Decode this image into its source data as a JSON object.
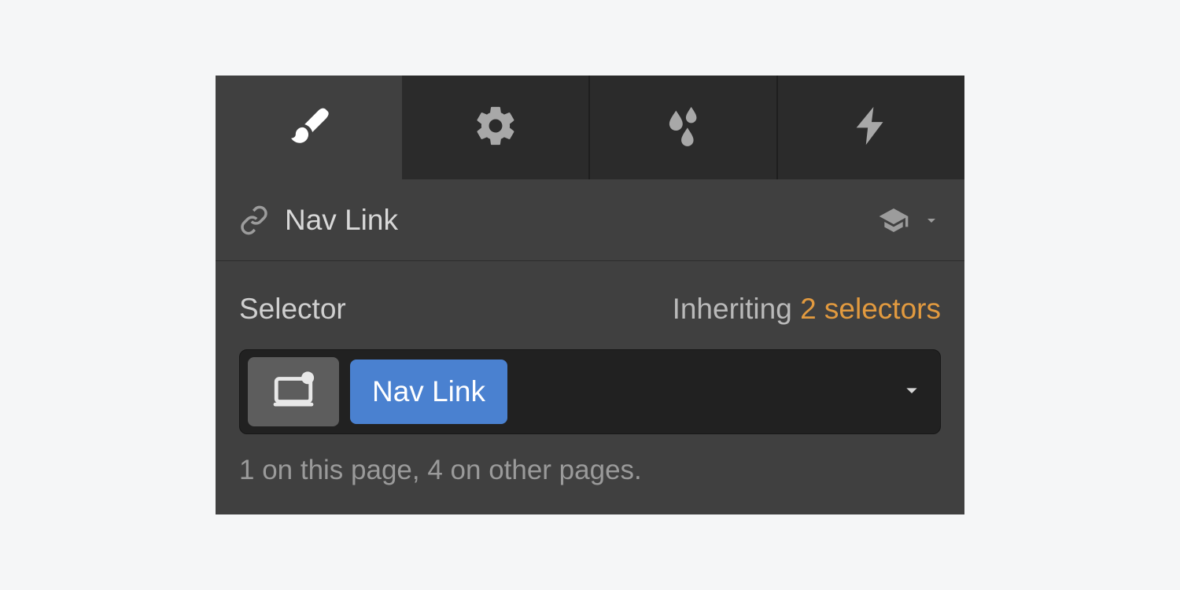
{
  "tabs": {
    "style": "style",
    "settings": "settings",
    "effects": "effects",
    "interactions": "interactions"
  },
  "element": {
    "name": "Nav Link"
  },
  "selector": {
    "label": "Selector",
    "inheriting_label": "Inheriting",
    "inheriting_count": "2 selectors",
    "class_name": "Nav Link",
    "instance_text": "1 on this page, 4 on other pages."
  }
}
